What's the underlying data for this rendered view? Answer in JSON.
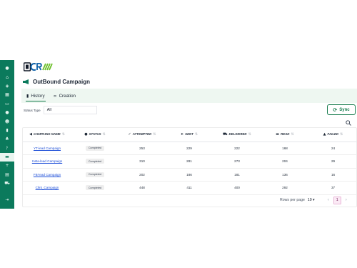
{
  "colors": {
    "accent": "#0b7a5c",
    "sync": "#137a4a",
    "tab_bg": "#eef7f1",
    "link": "#1d4ed8"
  },
  "sidebar": {
    "items": [
      {
        "icon": "dashboard-icon",
        "glyph": "●"
      },
      {
        "icon": "home-icon",
        "glyph": "⌂"
      },
      {
        "icon": "tag-icon",
        "glyph": "◈"
      },
      {
        "icon": "grid-icon",
        "glyph": "▦"
      },
      {
        "icon": "chat-icon",
        "glyph": "▭"
      },
      {
        "icon": "user-icon",
        "glyph": "●"
      },
      {
        "icon": "people-icon",
        "glyph": "☻"
      },
      {
        "icon": "document-icon",
        "glyph": "▮"
      },
      {
        "icon": "club-icon",
        "glyph": "♣"
      },
      {
        "icon": "flow-icon",
        "glyph": "ᚹ"
      },
      {
        "icon": "campaign-icon",
        "glyph": "▬"
      },
      {
        "icon": "plus-icon",
        "glyph": "+"
      },
      {
        "icon": "calendar-icon",
        "glyph": "▤"
      },
      {
        "icon": "cart-icon",
        "glyph": "⛟"
      },
      {
        "icon": "logout-icon",
        "glyph": "⇥"
      }
    ]
  },
  "header": {
    "title": "OutBound Campaign",
    "icon": "megaphone-icon"
  },
  "tabs": [
    {
      "label": "History",
      "icon": "file-icon",
      "glyph": "▮",
      "active": true
    },
    {
      "label": "Creation",
      "icon": "link-icon",
      "glyph": "∞",
      "active": false
    }
  ],
  "filter": {
    "label": "Status Type",
    "value": "All"
  },
  "sync": {
    "label": "Sync",
    "icon": "sync-icon"
  },
  "search": {
    "icon": "search-icon"
  },
  "table": {
    "columns": [
      {
        "label": "CAMPAING NAME",
        "icon": "megaphone-icon",
        "glyph": "◀"
      },
      {
        "label": "STATUS",
        "icon": "status-icon",
        "glyph": "●"
      },
      {
        "label": "ATTEMPTED",
        "icon": "check-icon",
        "glyph": "✓"
      },
      {
        "label": "SENT",
        "icon": "send-icon",
        "glyph": "➤"
      },
      {
        "label": "DELIVERED",
        "icon": "truck-icon",
        "glyph": "⛟"
      },
      {
        "label": "READ",
        "icon": "read-icon",
        "glyph": "▬"
      },
      {
        "label": "FAILED",
        "icon": "warning-icon",
        "glyph": "▲"
      }
    ],
    "rows": [
      {
        "name": "YT-lead Campaign",
        "status": "Completed",
        "attempted": "253",
        "sent": "229",
        "delivered": "222",
        "read": "168",
        "failed": "24"
      },
      {
        "name": "Insta-lead Campaign",
        "status": "Completed",
        "attempted": "310",
        "sent": "281",
        "delivered": "273",
        "read": "204",
        "failed": "29"
      },
      {
        "name": "FB-lead Campaign",
        "status": "Completed",
        "attempted": "202",
        "sent": "186",
        "delivered": "181",
        "read": "136",
        "failed": "16"
      },
      {
        "name": "Clint_Campaign",
        "status": "Completed",
        "attempted": "448",
        "sent": "411",
        "delivered": "400",
        "read": "292",
        "failed": "37"
      }
    ]
  },
  "pagination": {
    "rows_label": "Rows per page",
    "rows_value": "10",
    "current_page": "1"
  }
}
